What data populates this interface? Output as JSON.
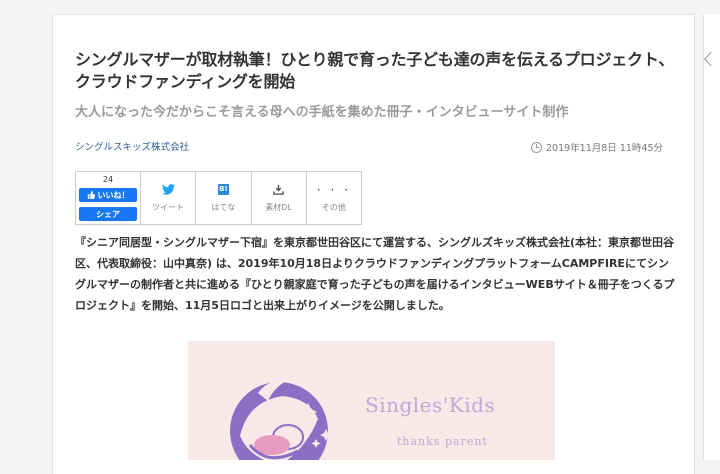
{
  "article": {
    "title": "シングルマザーが取材執筆！ひとり親で育った子ども達の声を伝えるプロジェクト、クラウドファンディングを開始",
    "subtitle": "大人になった今だからこそ言える母への手紙を集めた冊子・インタビューサイト制作",
    "company": "シングルスキッズ株式会社",
    "date": "2019年11月8日 11時45分",
    "body": "『シニア同居型・シングルマザー下宿』を東京都世田谷区にて運営する、シングルズキッズ株式会社(本社：東京都世田谷区、代表取締役：山中真奈) は、2019年10月18日よりクラウドファンディングプラットフォームCAMPFIREにてシングルマザーの制作者と共に進める『ひとり親家庭で育った子どもの声を届けるインタビューWEBサイト＆冊子をつくるプロジェクト』を開始、11月5日ロゴと出来上がりイメージを公開しました。"
  },
  "share": {
    "fb_count": "24",
    "like_label": "いいね！",
    "share_label": "シェア",
    "tweet_label": "ツイート",
    "hatena_label": "はてな",
    "hatena_glyph": "B!",
    "material_label": "素材DL",
    "more_label": "その他",
    "more_glyph": "· · ·"
  },
  "image": {
    "logo_text": "Singles'Kids",
    "logo_sub": "thanks parent"
  },
  "colors": {
    "facebook": "#1877f2",
    "twitter": "#1da1f2",
    "hatena": "#2d8ad9",
    "company_link": "#2a5c9a",
    "image_bg": "#fae7e7",
    "logo_purple": "#8a6fc4"
  },
  "icons": [
    "thumbs-up-icon",
    "twitter-bird-icon",
    "hatena-icon",
    "download-icon",
    "more-dots-icon",
    "clock-icon",
    "chevron-left-icon"
  ]
}
